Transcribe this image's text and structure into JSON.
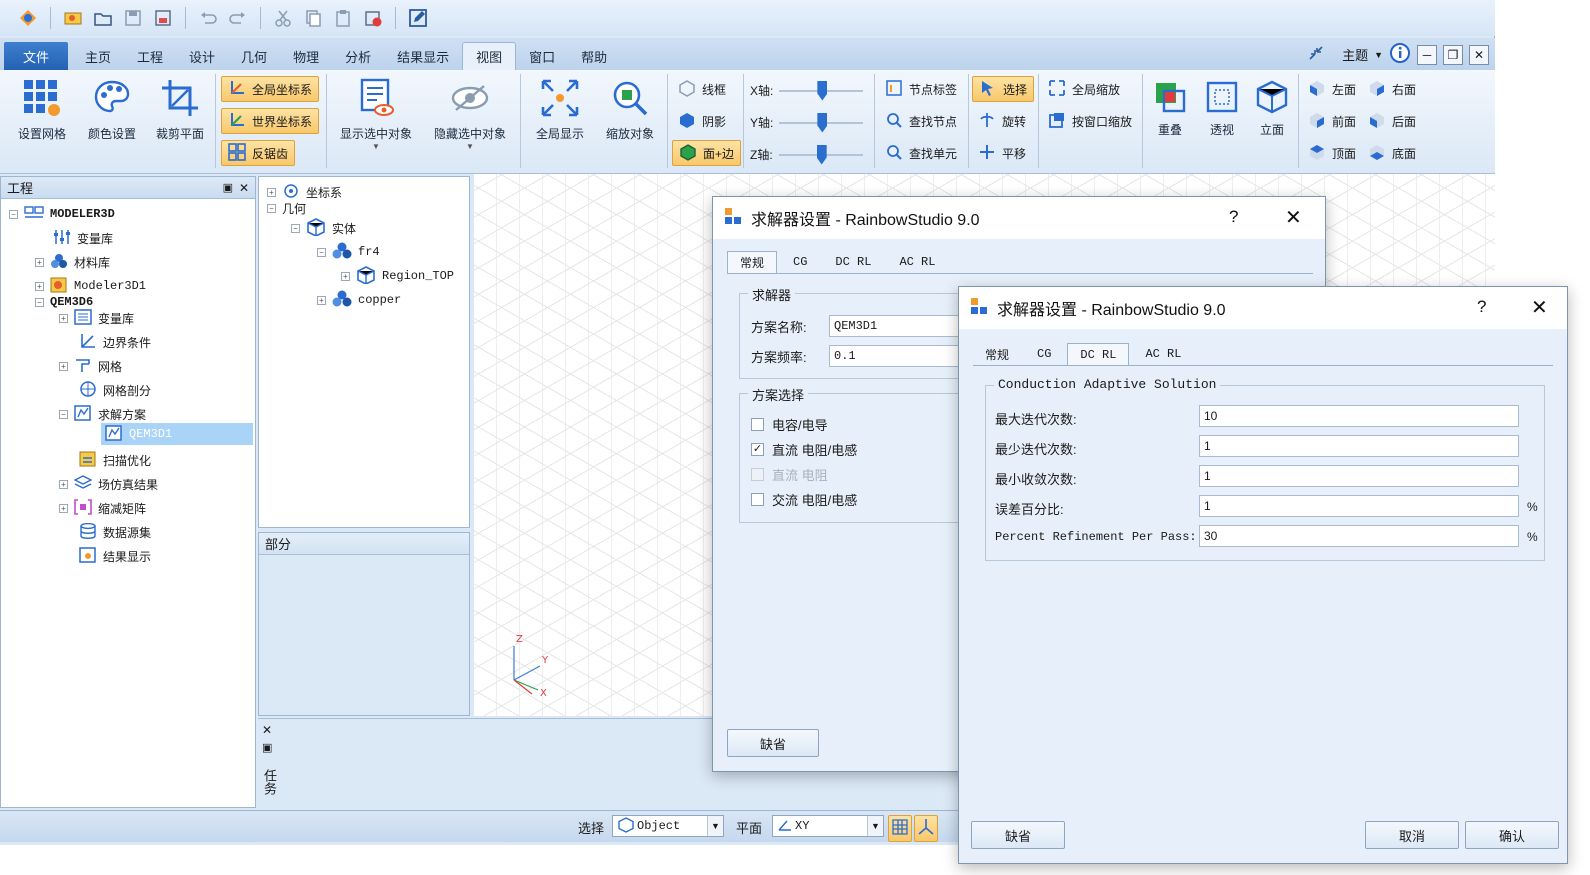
{
  "menu": {
    "file": "文件",
    "items": [
      "主页",
      "工程",
      "设计",
      "几何",
      "物理",
      "分析",
      "结果显示",
      "视图",
      "窗口",
      "帮助"
    ],
    "active": "视图",
    "theme_label": "主题"
  },
  "ribbon": {
    "set_grid": "设置网格",
    "color_settings": "颜色设置",
    "clip_plane": "裁剪平面",
    "global_coord": "全局坐标系",
    "world_coord": "世界坐标系",
    "anti_aliasing": "反锯齿",
    "show_selected": "显示选中对象",
    "hide_selected": "隐藏选中对象",
    "fit_all": "全局显示",
    "zoom_object": "缩放对象",
    "wireframe": "线框",
    "shading": "阴影",
    "face_edge": "面+边",
    "x_axis": "X轴:",
    "y_axis": "Y轴:",
    "z_axis": "Z轴:",
    "node_labels": "节点标签",
    "find_node": "查找节点",
    "find_element": "查找单元",
    "select": "选择",
    "rotate": "旋转",
    "pan": "平移",
    "global_zoom": "全局缩放",
    "window_zoom": "按窗口缩放",
    "overlap": "重叠",
    "perspective": "透视",
    "elevation": "立面",
    "left_view": "左面",
    "right_view": "右面",
    "front_view": "前面",
    "back_view": "后面",
    "top_view": "顶面",
    "bottom_view": "底面"
  },
  "project_panel": {
    "title": "工程",
    "root": "MODELER3D",
    "items": [
      "变量库",
      "材料库",
      "Modeler3D1"
    ],
    "qem": "QEM3D6",
    "qem_items": [
      "变量库",
      "边界条件",
      "网格",
      "网格剖分",
      "求解方案",
      "QEM3D1",
      "扫描优化",
      "场仿真结果",
      "缩减矩阵",
      "数据源集",
      "结果显示"
    ],
    "selected": "QEM3D1"
  },
  "model_tree": {
    "coord": "坐标系",
    "geometry": "几何",
    "solid": "实体",
    "fr4": "fr4",
    "region": "Region_TOP",
    "copper": "copper"
  },
  "parts_panel": {
    "title": "部分"
  },
  "task_panel": {
    "title": "任务"
  },
  "statusbar": {
    "select_label": "选择",
    "select_value": "Object",
    "plane_label": "平面",
    "plane_value": "XY"
  },
  "axis_labels": {
    "x": "X",
    "y": "Y",
    "z": "Z"
  },
  "dialog1": {
    "title": "求解器设置 - RainbowStudio 9.0",
    "help": "?",
    "close": "✕",
    "tabs": [
      "常规",
      "CG",
      "DC RL",
      "AC RL"
    ],
    "active_tab": "常规",
    "solver_group": "求解器",
    "name_label": "方案名称:",
    "name_value": "QEM3D1",
    "freq_label": "方案频率:",
    "freq_value": "0.1",
    "select_group": "方案选择",
    "options": [
      {
        "label": "电容/电导",
        "checked": false,
        "disabled": false
      },
      {
        "label": "直流 电阻/电感",
        "checked": true,
        "disabled": false
      },
      {
        "label": "直流 电阻",
        "checked": false,
        "disabled": true
      },
      {
        "label": "交流 电阻/电感",
        "checked": false,
        "disabled": false
      }
    ],
    "default_btn": "缺省"
  },
  "dialog2": {
    "title": "求解器设置 - RainbowStudio 9.0",
    "help": "?",
    "close": "✕",
    "tabs": [
      "常规",
      "CG",
      "DC RL",
      "AC RL"
    ],
    "active_tab": "DC RL",
    "group": "Conduction Adaptive Solution",
    "fields": [
      {
        "label": "最大迭代次数:",
        "value": "10",
        "unit": ""
      },
      {
        "label": "最少迭代次数:",
        "value": "1",
        "unit": ""
      },
      {
        "label": "最小收敛次数:",
        "value": "1",
        "unit": ""
      },
      {
        "label": "误差百分比:",
        "value": "1",
        "unit": "%"
      },
      {
        "label": "Percent Refinement Per Pass:",
        "value": "30",
        "unit": "%"
      }
    ],
    "default_btn": "缺省",
    "cancel_btn": "取消",
    "ok_btn": "确认"
  }
}
